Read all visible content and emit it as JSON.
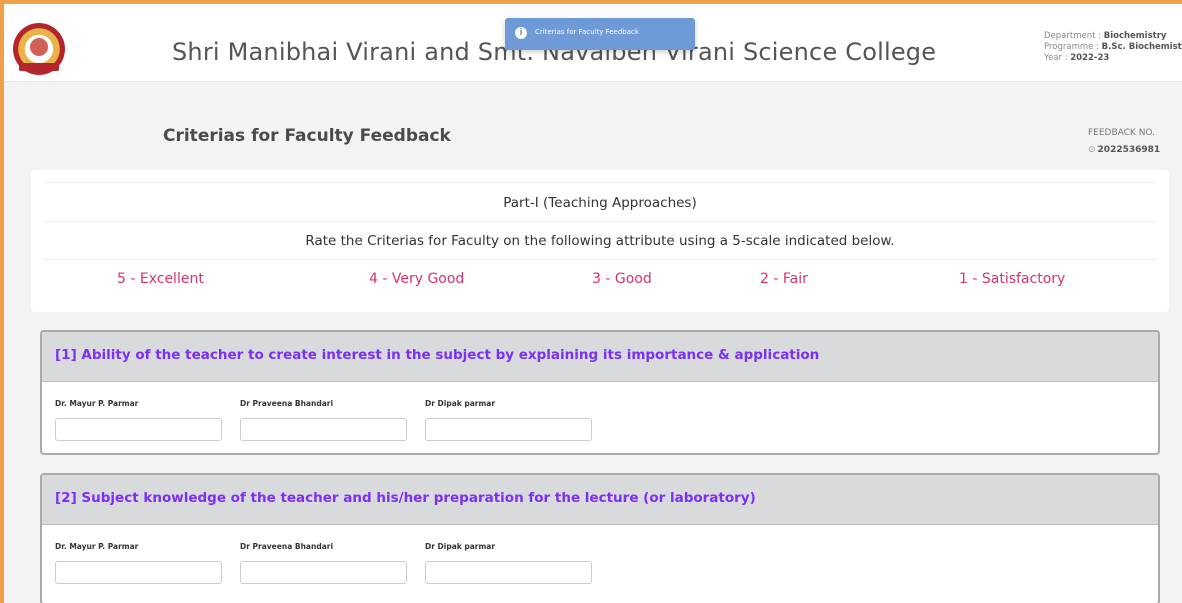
{
  "header": {
    "college_name": "Shri Manibhai Virani and Smt. Navalben Virani Science College",
    "department_label": "Department :",
    "department_value": "Biochemistry",
    "programme_label": "Programme :",
    "programme_value": "B.Sc. Biochemistry",
    "year_label": "Year :",
    "year_value": "2022-23",
    "logo_icon": "college-seal-logo"
  },
  "toast": {
    "icon": "info-icon",
    "text": "Criterias for Faculty Feedback"
  },
  "page": {
    "title": "Criterias for Faculty Feedback",
    "feedback_label": "FEEDBACK NO.",
    "feedback_icon": "⊙",
    "feedback_number": "2022536981"
  },
  "scale_card": {
    "part_title": "Part-I (Teaching Approaches)",
    "instruction": "Rate the Criterias for Faculty on the following attribute using a 5-scale indicated below.",
    "scale": [
      "5 - Excellent",
      "4 - Very Good",
      "3 - Good",
      "2 - Fair",
      "1 - Satisfactory"
    ],
    "scale_color": "#d6336c"
  },
  "questions": [
    {
      "title": "[1] Ability of the teacher to create interest in the subject by explaining its importance & application",
      "faculty": [
        "Dr. Mayur P. Parmar",
        "Dr Praveena Bhandari",
        "Dr Dipak parmar"
      ]
    },
    {
      "title": "[2] Subject knowledge of the teacher and his/her preparation for the lecture (or laboratory)",
      "faculty": [
        "Dr. Mayur P. Parmar",
        "Dr Praveena Bhandari",
        "Dr Dipak parmar"
      ]
    }
  ],
  "colors": {
    "accent_border": "#f0a04b",
    "question_title": "#7b2ff7",
    "toast_bg": "#6e9ad8"
  }
}
